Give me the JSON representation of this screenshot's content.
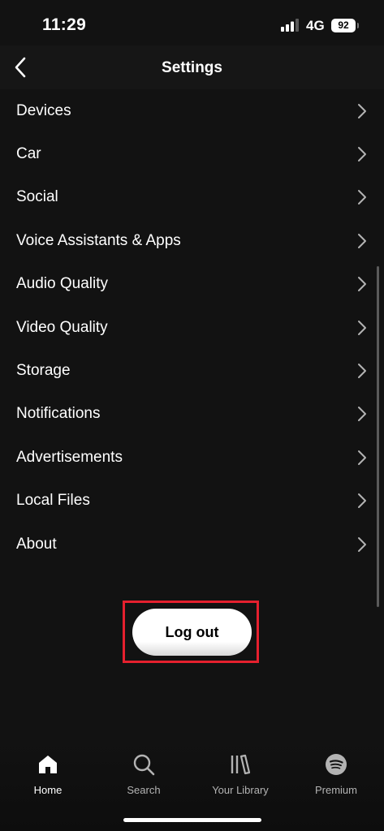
{
  "status_bar": {
    "time": "11:29",
    "network": "4G",
    "battery": "92"
  },
  "header": {
    "title": "Settings",
    "back_icon": "chevron-left-icon"
  },
  "settings": {
    "items": [
      {
        "label": "Devices"
      },
      {
        "label": "Car"
      },
      {
        "label": "Social"
      },
      {
        "label": "Voice Assistants & Apps"
      },
      {
        "label": "Audio Quality"
      },
      {
        "label": "Video Quality"
      },
      {
        "label": "Storage"
      },
      {
        "label": "Notifications"
      },
      {
        "label": "Advertisements"
      },
      {
        "label": "Local Files"
      },
      {
        "label": "About"
      }
    ],
    "chevron_icon": "chevron-right-icon"
  },
  "logout": {
    "label": "Log out",
    "highlight_color": "#e5202e"
  },
  "bottom_nav": {
    "items": [
      {
        "label": "Home",
        "icon": "home-icon",
        "active": true
      },
      {
        "label": "Search",
        "icon": "search-icon",
        "active": false
      },
      {
        "label": "Your Library",
        "icon": "library-icon",
        "active": false
      },
      {
        "label": "Premium",
        "icon": "spotify-logo-icon",
        "active": false
      }
    ]
  },
  "colors": {
    "background": "#121212",
    "text": "#ffffff",
    "inactive_text": "#b3b3b3"
  }
}
